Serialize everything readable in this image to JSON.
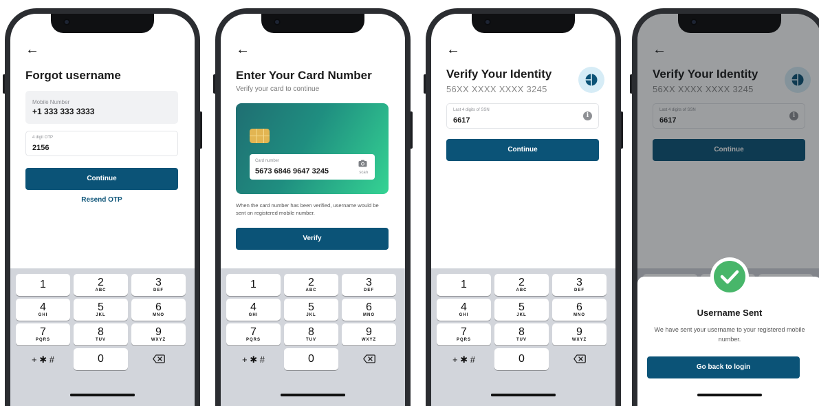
{
  "screens": {
    "forgot": {
      "title": "Forgot username",
      "mobile_label": "Mobile Number",
      "mobile_value": "+1 333 333 3333",
      "otp_label": "4 digit OTP",
      "otp_value": "2156",
      "continue_label": "Continue",
      "resend_label": "Resend OTP"
    },
    "card": {
      "title": "Enter Your Card Number",
      "subtitle": "Verify your card to continue",
      "card_label": "Card number",
      "card_value": "5673 6846 9647 3245",
      "scan_label": "scan",
      "note": "When the card number has been verified, username would be sent on registered mobile number.",
      "verify_label": "Verify"
    },
    "verify": {
      "title": "Verify Your Identity",
      "masked_card": "56XX XXXX XXXX 3245",
      "ssn_label": "Last 4 digits of SSN",
      "ssn_value": "6617",
      "continue_label": "Continue"
    },
    "success": {
      "title": "Username Sent",
      "message": "We have sent your username to your registered mobile number.",
      "button_label": "Go back to login"
    }
  },
  "keypad": {
    "keys": [
      {
        "n": "1",
        "l": ""
      },
      {
        "n": "2",
        "l": "ABC"
      },
      {
        "n": "3",
        "l": "DEF"
      },
      {
        "n": "4",
        "l": "GHI"
      },
      {
        "n": "5",
        "l": "JKL"
      },
      {
        "n": "6",
        "l": "MNO"
      },
      {
        "n": "7",
        "l": "PQRS"
      },
      {
        "n": "8",
        "l": "TUV"
      },
      {
        "n": "9",
        "l": "WXYZ"
      }
    ],
    "symbols": "+ ✱ #",
    "zero": "0"
  },
  "icons": {
    "back": "back-arrow-icon",
    "info": "info-icon",
    "camera": "camera-icon",
    "delete": "backspace-icon",
    "success": "check-circle-icon",
    "avatar": "avatar-logo-icon"
  },
  "colors": {
    "primary": "#0b5377",
    "success": "#48b66a",
    "keypad_bg": "#d2d5db"
  }
}
